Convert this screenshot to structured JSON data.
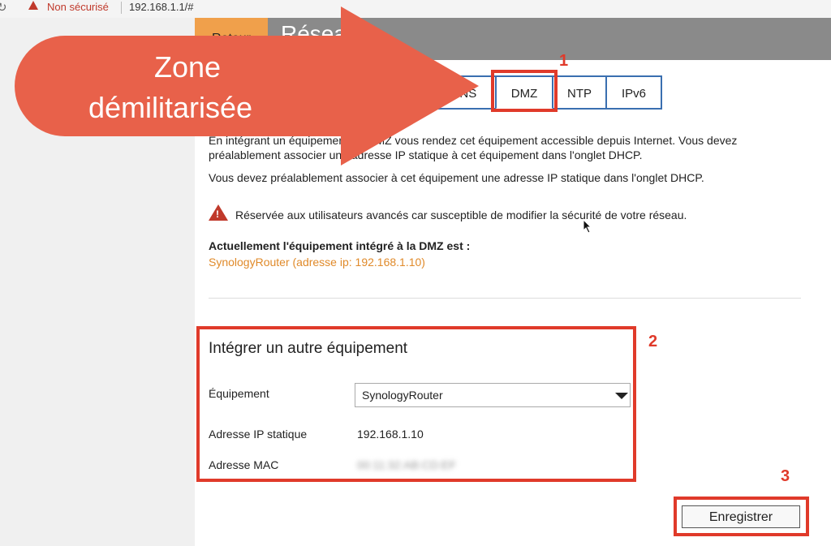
{
  "browser": {
    "security_label": "Non sécurisé",
    "url": "192.168.1.1/#"
  },
  "header": {
    "back_label": "Retour",
    "title": "Réseau"
  },
  "tabs": [
    {
      "label": "DDNS"
    },
    {
      "label": "DMZ",
      "active": true
    },
    {
      "label": "NTP"
    },
    {
      "label": "IPv6"
    }
  ],
  "content": {
    "intro": "En intégrant un équipement en DMZ vous rendez cet équipement accessible depuis Internet. Vous devez préalablement associer une adresse IP statique à cet équipement dans l'onglet DHCP.",
    "intro2": "Vous devez préalablement associer à cet équipement une adresse IP statique dans l'onglet DHCP.",
    "warning": "Réservée aux utilisateurs avancés car susceptible de modifier la sécurité de votre réseau.",
    "current_label": "Actuellement l'équipement intégré à la DMZ est :",
    "current_value": "SynologyRouter (adresse ip: 192.168.1.10)"
  },
  "form": {
    "section_title": "Intégrer un autre équipement",
    "equipment_label": "Équipement",
    "equipment_value": "SynologyRouter",
    "ip_label": "Adresse IP statique",
    "ip_value": "192.168.1.10",
    "mac_label": "Adresse MAC",
    "mac_value": "00:11:32:AB:CD:EF",
    "save_label": "Enregistrer"
  },
  "annotations": {
    "arrow_line1": "Zone",
    "arrow_line2": "démilitarisée",
    "num1": "1",
    "num2": "2",
    "num3": "3",
    "color": "#e03a2a",
    "arrow_color": "#e8614a"
  }
}
